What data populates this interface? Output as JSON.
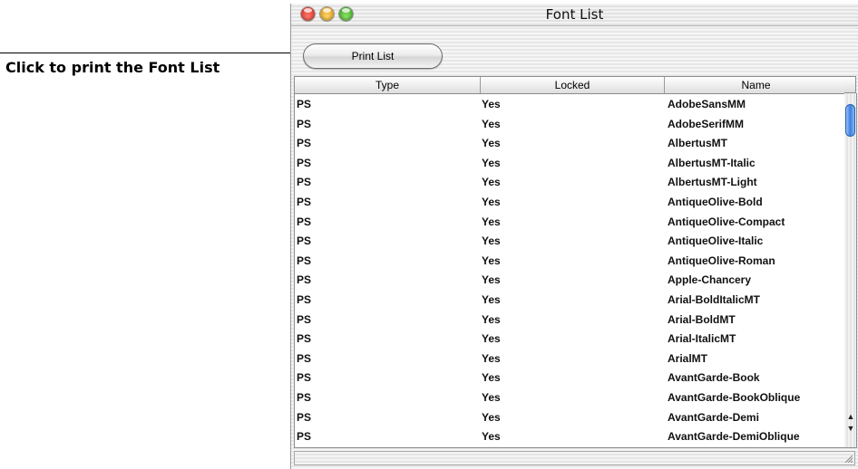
{
  "callout": {
    "text": "Click to print the Font List"
  },
  "window": {
    "title": "Font List"
  },
  "toolbar": {
    "print_label": "Print List"
  },
  "table": {
    "columns": [
      "Type",
      "Locked",
      "Name"
    ],
    "rows": [
      {
        "type": "PS",
        "locked": "Yes",
        "name": "AdobeSansMM"
      },
      {
        "type": "PS",
        "locked": "Yes",
        "name": "AdobeSerifMM"
      },
      {
        "type": "PS",
        "locked": "Yes",
        "name": "AlbertusMT"
      },
      {
        "type": "PS",
        "locked": "Yes",
        "name": "AlbertusMT-Italic"
      },
      {
        "type": "PS",
        "locked": "Yes",
        "name": "AlbertusMT-Light"
      },
      {
        "type": "PS",
        "locked": "Yes",
        "name": "AntiqueOlive-Bold"
      },
      {
        "type": "PS",
        "locked": "Yes",
        "name": "AntiqueOlive-Compact"
      },
      {
        "type": "PS",
        "locked": "Yes",
        "name": "AntiqueOlive-Italic"
      },
      {
        "type": "PS",
        "locked": "Yes",
        "name": "AntiqueOlive-Roman"
      },
      {
        "type": "PS",
        "locked": "Yes",
        "name": "Apple-Chancery"
      },
      {
        "type": "PS",
        "locked": "Yes",
        "name": "Arial-BoldItalicMT"
      },
      {
        "type": "PS",
        "locked": "Yes",
        "name": "Arial-BoldMT"
      },
      {
        "type": "PS",
        "locked": "Yes",
        "name": "Arial-ItalicMT"
      },
      {
        "type": "PS",
        "locked": "Yes",
        "name": "ArialMT"
      },
      {
        "type": "PS",
        "locked": "Yes",
        "name": "AvantGarde-Book"
      },
      {
        "type": "PS",
        "locked": "Yes",
        "name": "AvantGarde-BookOblique"
      },
      {
        "type": "PS",
        "locked": "Yes",
        "name": "AvantGarde-Demi"
      },
      {
        "type": "PS",
        "locked": "Yes",
        "name": "AvantGarde-DemiOblique"
      }
    ]
  },
  "scrollbar": {
    "up_arrow_icon": "up-arrow-icon",
    "down_arrow_icon": "down-arrow-icon"
  },
  "colors": {
    "close": "#d3271a",
    "minimize": "#d9900d",
    "zoom": "#2f9e17",
    "scroll_thumb": "#3a7fe0"
  }
}
